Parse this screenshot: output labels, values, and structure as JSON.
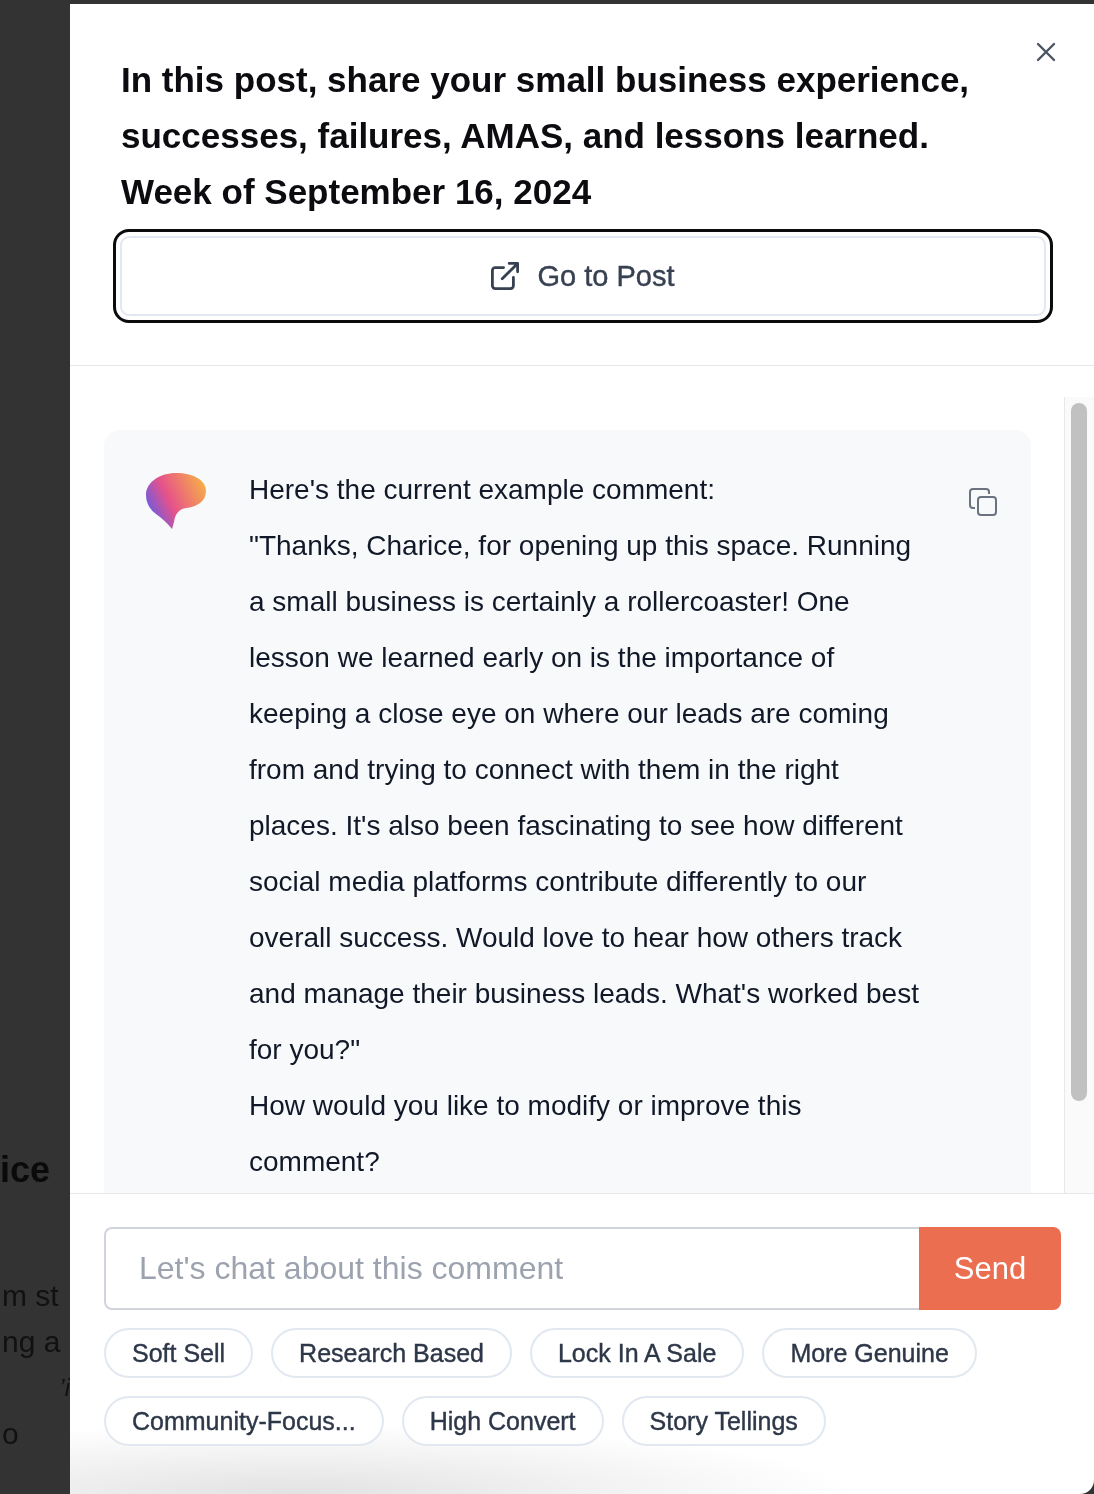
{
  "background_page": {
    "heading": "ice",
    "lines": [
      "m st",
      "ng a",
      "’i",
      "o"
    ]
  },
  "dialog": {
    "title": "In this post, share your small business experience, successes, failures, AMAS, and lessons learned.",
    "subtitle": "Week of September 16, 2024",
    "go_to_post_button": {
      "label": "Go to Post",
      "focused": true
    }
  },
  "chat": {
    "messages": [
      {
        "kind": "assistant",
        "paragraphs": [
          "Here's the current example comment:",
          "\"Thanks, Charice, for opening up this space. Running a small business is certainly a rollercoaster! One lesson we learned early on is the importance of keeping a close eye on where our leads are coming from and trying to connect with them in the right places. It's also been fascinating to see how different social media platforms contribute differently to our overall success. Would love to hear how others track and manage their business leads. What's worked best for you?\"",
          "How would you like to modify or improve this comment?"
        ]
      }
    ]
  },
  "composer": {
    "placeholder": "Let's chat about this comment",
    "send_label": "Send"
  },
  "suggestions": [
    "Soft Sell",
    "Research Based",
    "Lock In A Sale",
    "More Genuine",
    "Community-Focus...",
    "High Convert",
    "Story Tellings"
  ]
}
